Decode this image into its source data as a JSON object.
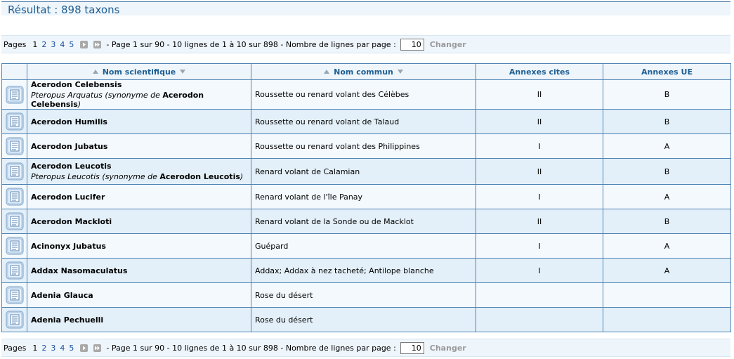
{
  "header": {
    "title": "Résultat : 898 taxons"
  },
  "pager": {
    "pages_label": "Pages",
    "pages": [
      "1",
      "2",
      "3",
      "4",
      "5"
    ],
    "info": "- Page 1 sur 90 - 10 lignes de 1 à 10 sur 898 - Nombre de lignes par page :",
    "rows_per_page": "10",
    "change_label": "Changer"
  },
  "table": {
    "headers": {
      "sci": "Nom scientifique",
      "com": "Nom commun",
      "cites": "Annexes cites",
      "ue": "Annexes UE"
    },
    "rows": [
      {
        "sci": "Acerodon Celebensis",
        "syn_name": "Pteropus Arquatus",
        "syn_text": "(synonyme de",
        "syn_ref": "Acerodon Celebensis",
        "syn_close": ")",
        "com": "Roussette ou renard volant des Célèbes",
        "cites": "II",
        "ue": "B"
      },
      {
        "sci": "Acerodon Humilis",
        "com": "Roussette ou renard volant de Talaud",
        "cites": "II",
        "ue": "B"
      },
      {
        "sci": "Acerodon Jubatus",
        "com": "Roussette ou renard volant des Philippines",
        "cites": "I",
        "ue": "A"
      },
      {
        "sci": "Acerodon Leucotis",
        "syn_name": "Pteropus Leucotis",
        "syn_text": "(synonyme de",
        "syn_ref": "Acerodon Leucotis",
        "syn_close": ")",
        "com": "Renard volant de Calamian",
        "cites": "II",
        "ue": "B"
      },
      {
        "sci": "Acerodon Lucifer",
        "com": "Renard volant de l'île Panay",
        "cites": "I",
        "ue": "A"
      },
      {
        "sci": "Acerodon Mackloti",
        "com": "Renard volant de la Sonde ou de Macklot",
        "cites": "II",
        "ue": "B"
      },
      {
        "sci": "Acinonyx Jubatus",
        "com": "Guépard",
        "cites": "I",
        "ue": "A"
      },
      {
        "sci": "Addax Nasomaculatus",
        "com": "Addax; Addax à nez tacheté; Antilope blanche",
        "cites": "I",
        "ue": "A"
      },
      {
        "sci": "Adenia Glauca",
        "com": "Rose du désert",
        "cites": "",
        "ue": ""
      },
      {
        "sci": "Adenia Pechuelli",
        "com": "Rose du désert",
        "cites": "",
        "ue": ""
      }
    ]
  }
}
